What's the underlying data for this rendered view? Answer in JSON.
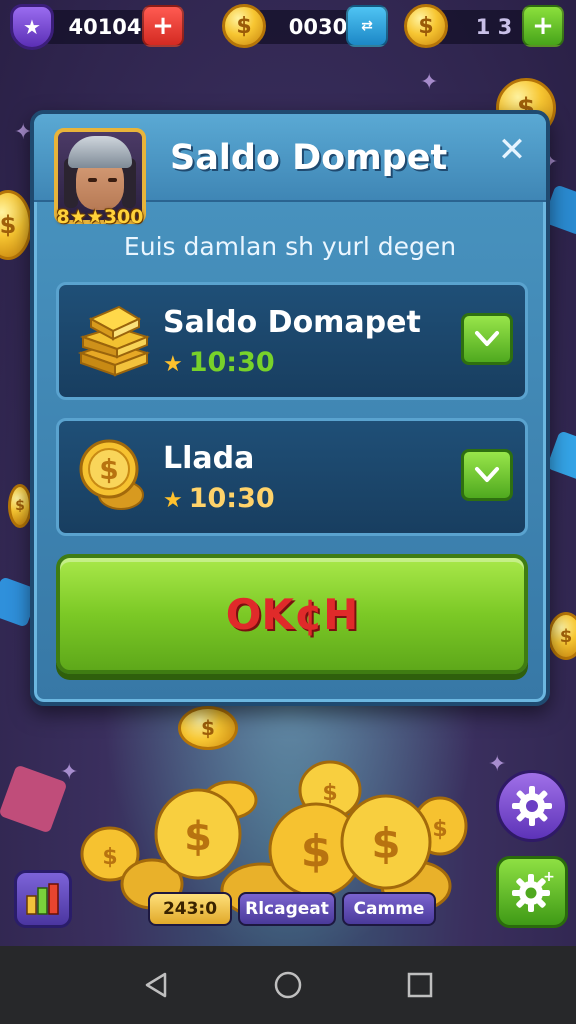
{
  "topbar": {
    "gems": "40104",
    "coins": "0030",
    "tickets": "1 3",
    "add_gems_icon": "plus-icon",
    "exchange_icon": "exchange-icon",
    "add_tickets_icon": "plus-icon"
  },
  "modal": {
    "title": "Saldo Dompet",
    "subtitle": "Euis damlan sh yurl degen",
    "avatar_level": "8★★300",
    "close_label": "✕",
    "items": [
      {
        "name": "Saldo Domapet",
        "time": "10:30",
        "icon": "gold-bars-icon"
      },
      {
        "name": "Llada",
        "time": "10:30",
        "icon": "coin-stack-icon"
      }
    ],
    "ok_label": "OK¢H"
  },
  "bottom": {
    "score": "243:0",
    "label_a": "Rlcageat",
    "label_b": "Camme"
  },
  "colors": {
    "accent_green": "#7cc926",
    "panel_blue": "#3f86b5",
    "ok_text_red": "#e02a2a",
    "gold": "#f7c632"
  }
}
